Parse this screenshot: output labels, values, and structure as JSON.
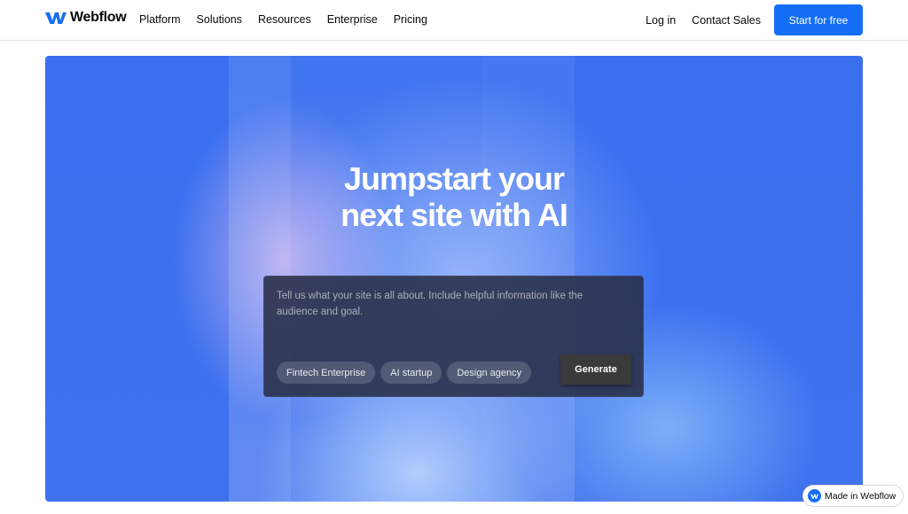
{
  "nav": {
    "logo_text": "Webflow",
    "links": [
      "Platform",
      "Solutions",
      "Resources",
      "Enterprise",
      "Pricing"
    ],
    "login": "Log in",
    "contact": "Contact Sales",
    "cta": "Start for free"
  },
  "hero": {
    "headline_line1": "Jumpstart your",
    "headline_line2": "next site with AI",
    "prompt_placeholder": "Tell us what your site is all about. Include helpful information like the audience and goal.",
    "chips": [
      "Fintech Enterprise",
      "AI startup",
      "Design agency"
    ],
    "generate": "Generate"
  },
  "badge": {
    "label": "Made in Webflow"
  },
  "colors": {
    "brand": "#146ef5",
    "hero_bg": "#3a6ff0",
    "prompt_bg": "#282e46",
    "generate_bg": "#3b3a3a"
  }
}
